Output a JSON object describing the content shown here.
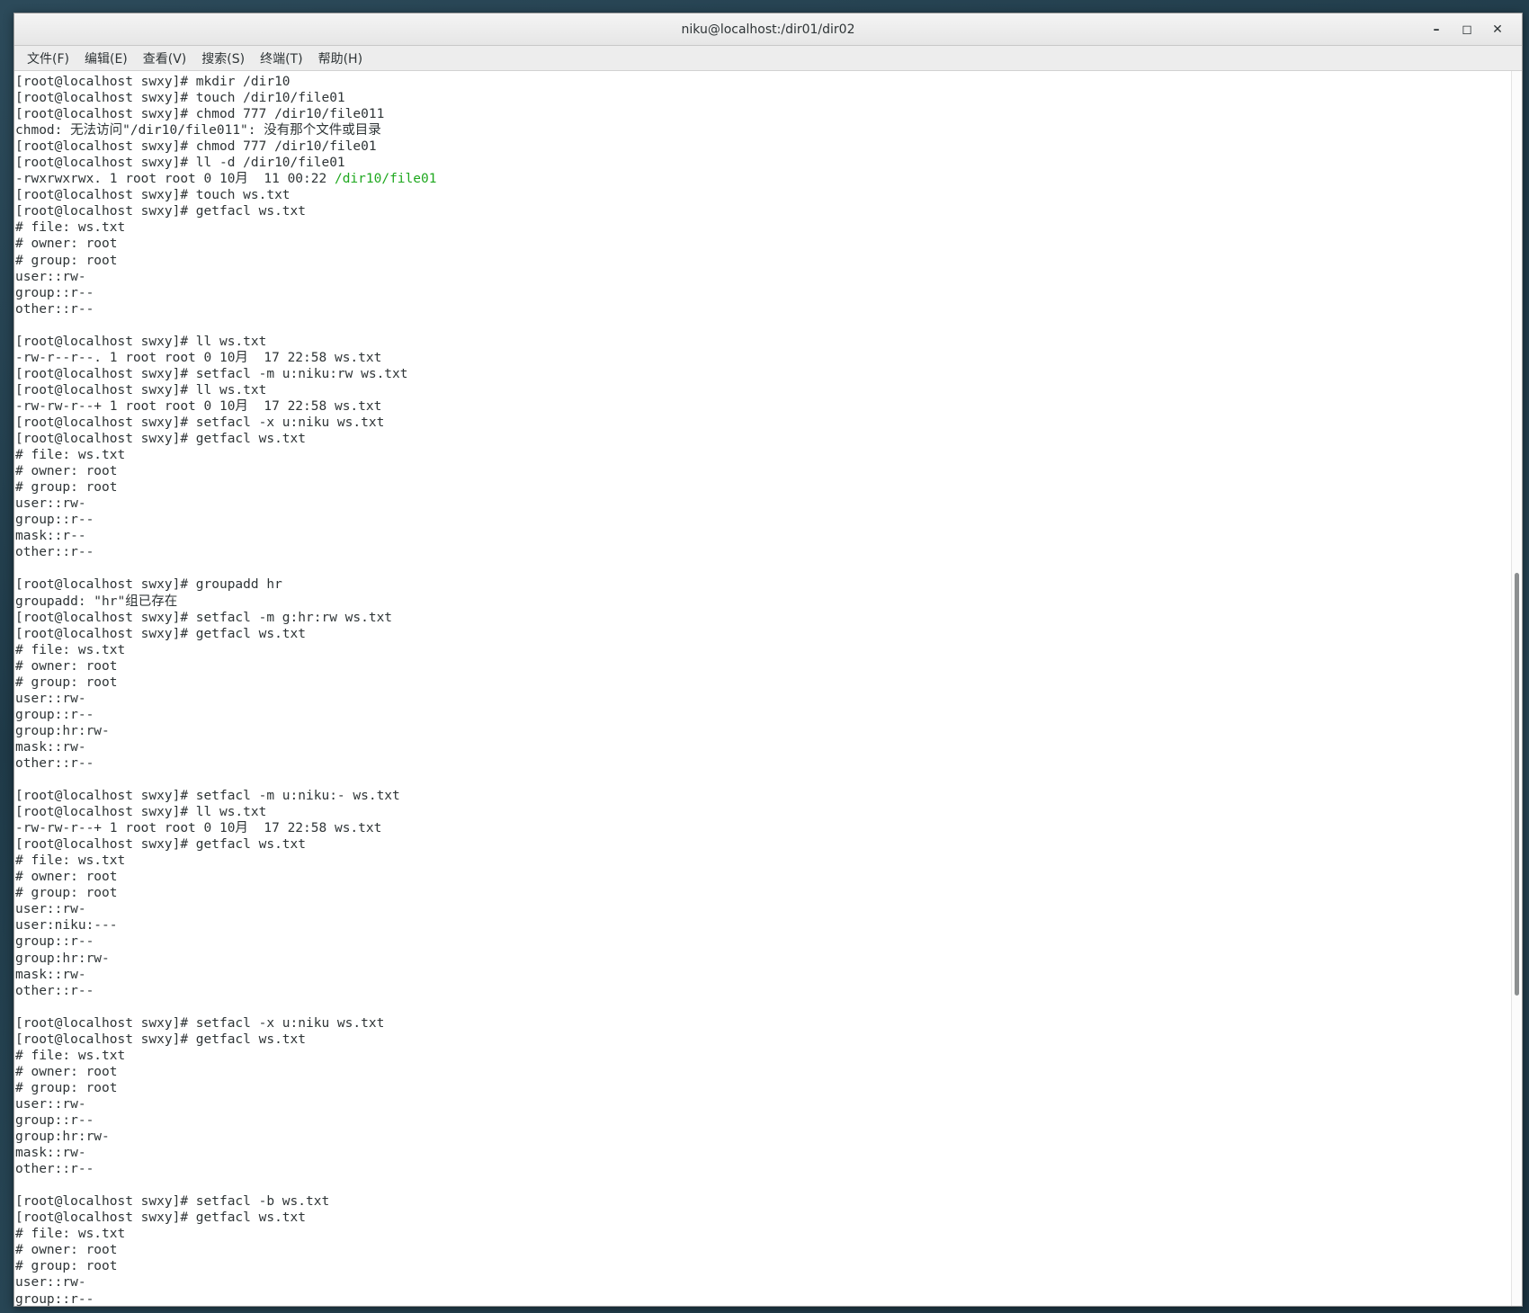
{
  "window": {
    "title": "niku@localhost:/dir01/dir02",
    "controls": [
      {
        "name": "minimize",
        "glyph": "–"
      },
      {
        "name": "maximize",
        "glyph": "◻"
      },
      {
        "name": "close",
        "glyph": "✕"
      }
    ]
  },
  "menu": {
    "file": "文件(F)",
    "edit": "编辑(E)",
    "view": "查看(V)",
    "search": "搜索(S)",
    "terminal": "终端(T)",
    "help": "帮助(H)"
  },
  "terminal": {
    "lines": [
      "[root@localhost swxy]# mkdir /dir10",
      "[root@localhost swxy]# touch /dir10/file01",
      "[root@localhost swxy]# chmod 777 /dir10/file011",
      "chmod: 无法访问\"/dir10/file011\": 没有那个文件或目录",
      "[root@localhost swxy]# chmod 777 /dir10/file01",
      "[root@localhost swxy]# ll -d /dir10/file01",
      "-rwxrwxrwx. 1 root root 0 10月  11 00:22 ",
      "[root@localhost swxy]# touch ws.txt",
      "[root@localhost swxy]# getfacl ws.txt",
      "# file: ws.txt",
      "# owner: root",
      "# group: root",
      "user::rw-",
      "group::r--",
      "other::r--",
      "",
      "[root@localhost swxy]# ll ws.txt",
      "-rw-r--r--. 1 root root 0 10月  17 22:58 ws.txt",
      "[root@localhost swxy]# setfacl -m u:niku:rw ws.txt",
      "[root@localhost swxy]# ll ws.txt",
      "-rw-rw-r--+ 1 root root 0 10月  17 22:58 ws.txt",
      "[root@localhost swxy]# setfacl -x u:niku ws.txt",
      "[root@localhost swxy]# getfacl ws.txt",
      "# file: ws.txt",
      "# owner: root",
      "# group: root",
      "user::rw-",
      "group::r--",
      "mask::r--",
      "other::r--",
      "",
      "[root@localhost swxy]# groupadd hr",
      "groupadd: \"hr\"组已存在",
      "[root@localhost swxy]# setfacl -m g:hr:rw ws.txt",
      "[root@localhost swxy]# getfacl ws.txt",
      "# file: ws.txt",
      "# owner: root",
      "# group: root",
      "user::rw-",
      "group::r--",
      "group:hr:rw-",
      "mask::rw-",
      "other::r--",
      "",
      "[root@localhost swxy]# setfacl -m u:niku:- ws.txt",
      "[root@localhost swxy]# ll ws.txt",
      "-rw-rw-r--+ 1 root root 0 10月  17 22:58 ws.txt",
      "[root@localhost swxy]# getfacl ws.txt",
      "# file: ws.txt",
      "# owner: root",
      "# group: root",
      "user::rw-",
      "user:niku:---",
      "group::r--",
      "group:hr:rw-",
      "mask::rw-",
      "other::r--",
      "",
      "[root@localhost swxy]# setfacl -x u:niku ws.txt",
      "[root@localhost swxy]# getfacl ws.txt",
      "# file: ws.txt",
      "# owner: root",
      "# group: root",
      "user::rw-",
      "group::r--",
      "group:hr:rw-",
      "mask::rw-",
      "other::r--",
      "",
      "[root@localhost swxy]# setfacl -b ws.txt",
      "[root@localhost swxy]# getfacl ws.txt",
      "# file: ws.txt",
      "# owner: root",
      "# group: root",
      "user::rw-",
      "group::r--"
    ],
    "highlight": {
      "line_index": 6,
      "text": "/dir10/file01",
      "color": "#1fa81f"
    }
  },
  "colors": {
    "text": "#2e3436",
    "background": "#ffffff",
    "executable_file": "#1fa81f"
  }
}
